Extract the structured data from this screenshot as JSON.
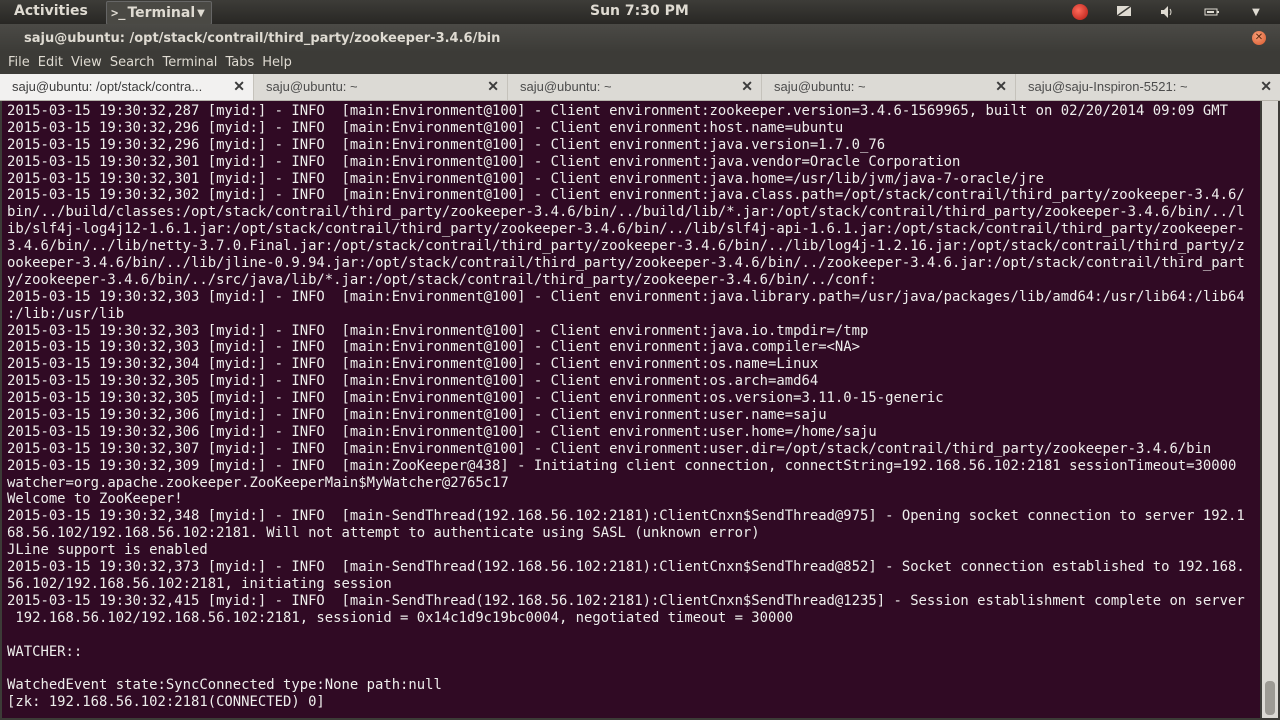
{
  "top_panel": {
    "activities": "Activities",
    "app_menu": "Terminal",
    "clock": "Sun  7:30 PM"
  },
  "window": {
    "title": "saju@ubuntu: /opt/stack/contrail/third_party/zookeeper-3.4.6/bin"
  },
  "menubar": {
    "items": [
      "File",
      "Edit",
      "View",
      "Search",
      "Terminal",
      "Tabs",
      "Help"
    ]
  },
  "tabs": [
    {
      "label": "saju@ubuntu: /opt/stack/contra..."
    },
    {
      "label": "saju@ubuntu: ~"
    },
    {
      "label": "saju@ubuntu: ~"
    },
    {
      "label": "saju@ubuntu: ~"
    },
    {
      "label": "saju@saju-Inspiron-5521: ~"
    }
  ],
  "terminal_lines": [
    "2015-03-15 19:30:32,287 [myid:] - INFO  [main:Environment@100] - Client environment:zookeeper.version=3.4.6-1569965, built on 02/20/2014 09:09 GMT",
    "2015-03-15 19:30:32,296 [myid:] - INFO  [main:Environment@100] - Client environment:host.name=ubuntu",
    "2015-03-15 19:30:32,296 [myid:] - INFO  [main:Environment@100] - Client environment:java.version=1.7.0_76",
    "2015-03-15 19:30:32,301 [myid:] - INFO  [main:Environment@100] - Client environment:java.vendor=Oracle Corporation",
    "2015-03-15 19:30:32,301 [myid:] - INFO  [main:Environment@100] - Client environment:java.home=/usr/lib/jvm/java-7-oracle/jre",
    "2015-03-15 19:30:32,302 [myid:] - INFO  [main:Environment@100] - Client environment:java.class.path=/opt/stack/contrail/third_party/zookeeper-3.4.6/",
    "bin/../build/classes:/opt/stack/contrail/third_party/zookeeper-3.4.6/bin/../build/lib/*.jar:/opt/stack/contrail/third_party/zookeeper-3.4.6/bin/../l",
    "ib/slf4j-log4j12-1.6.1.jar:/opt/stack/contrail/third_party/zookeeper-3.4.6/bin/../lib/slf4j-api-1.6.1.jar:/opt/stack/contrail/third_party/zookeeper-",
    "3.4.6/bin/../lib/netty-3.7.0.Final.jar:/opt/stack/contrail/third_party/zookeeper-3.4.6/bin/../lib/log4j-1.2.16.jar:/opt/stack/contrail/third_party/z",
    "ookeeper-3.4.6/bin/../lib/jline-0.9.94.jar:/opt/stack/contrail/third_party/zookeeper-3.4.6/bin/../zookeeper-3.4.6.jar:/opt/stack/contrail/third_part",
    "y/zookeeper-3.4.6/bin/../src/java/lib/*.jar:/opt/stack/contrail/third_party/zookeeper-3.4.6/bin/../conf:",
    "2015-03-15 19:30:32,303 [myid:] - INFO  [main:Environment@100] - Client environment:java.library.path=/usr/java/packages/lib/amd64:/usr/lib64:/lib64",
    ":/lib:/usr/lib",
    "2015-03-15 19:30:32,303 [myid:] - INFO  [main:Environment@100] - Client environment:java.io.tmpdir=/tmp",
    "2015-03-15 19:30:32,303 [myid:] - INFO  [main:Environment@100] - Client environment:java.compiler=<NA>",
    "2015-03-15 19:30:32,304 [myid:] - INFO  [main:Environment@100] - Client environment:os.name=Linux",
    "2015-03-15 19:30:32,305 [myid:] - INFO  [main:Environment@100] - Client environment:os.arch=amd64",
    "2015-03-15 19:30:32,305 [myid:] - INFO  [main:Environment@100] - Client environment:os.version=3.11.0-15-generic",
    "2015-03-15 19:30:32,306 [myid:] - INFO  [main:Environment@100] - Client environment:user.name=saju",
    "2015-03-15 19:30:32,306 [myid:] - INFO  [main:Environment@100] - Client environment:user.home=/home/saju",
    "2015-03-15 19:30:32,307 [myid:] - INFO  [main:Environment@100] - Client environment:user.dir=/opt/stack/contrail/third_party/zookeeper-3.4.6/bin",
    "2015-03-15 19:30:32,309 [myid:] - INFO  [main:ZooKeeper@438] - Initiating client connection, connectString=192.168.56.102:2181 sessionTimeout=30000",
    "watcher=org.apache.zookeeper.ZooKeeperMain$MyWatcher@2765c17",
    "Welcome to ZooKeeper!",
    "2015-03-15 19:30:32,348 [myid:] - INFO  [main-SendThread(192.168.56.102:2181):ClientCnxn$SendThread@975] - Opening socket connection to server 192.1",
    "68.56.102/192.168.56.102:2181. Will not attempt to authenticate using SASL (unknown error)",
    "JLine support is enabled",
    "2015-03-15 19:30:32,373 [myid:] - INFO  [main-SendThread(192.168.56.102:2181):ClientCnxn$SendThread@852] - Socket connection established to 192.168.",
    "56.102/192.168.56.102:2181, initiating session",
    "2015-03-15 19:30:32,415 [myid:] - INFO  [main-SendThread(192.168.56.102:2181):ClientCnxn$SendThread@1235] - Session establishment complete on server",
    " 192.168.56.102/192.168.56.102:2181, sessionid = 0x14c1d9c19bc0004, negotiated timeout = 30000",
    "",
    "WATCHER::",
    "",
    "WatchedEvent state:SyncConnected type:None path:null",
    "[zk: 192.168.56.102:2181(CONNECTED) 0]"
  ]
}
